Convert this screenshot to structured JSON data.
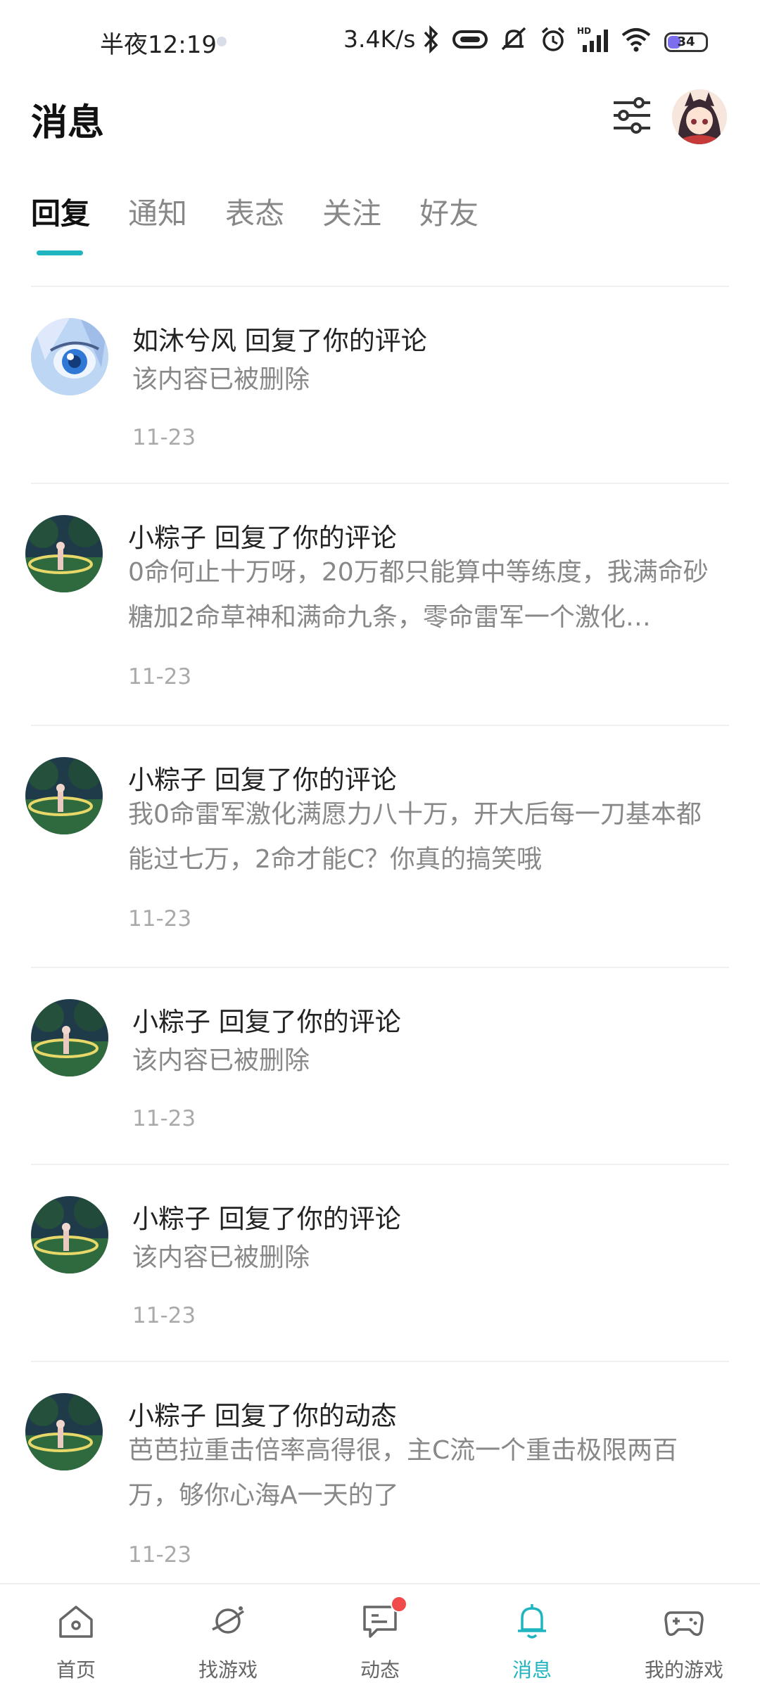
{
  "status_bar": {
    "time": "半夜12:19",
    "net_speed": "3.4K/s",
    "battery": "34",
    "battery_level": 0.34,
    "icons": [
      "bluetooth-icon",
      "vibrate-icon",
      "mute-icon",
      "alarm-icon",
      "signal-icon",
      "wifi-icon",
      "battery-icon"
    ]
  },
  "header": {
    "title": "消息",
    "filter_icon": "filter-sliders-icon"
  },
  "tabs": [
    {
      "label": "回复",
      "active": true
    },
    {
      "label": "通知",
      "active": false
    },
    {
      "label": "表态",
      "active": false
    },
    {
      "label": "关注",
      "active": false
    },
    {
      "label": "好友",
      "active": false
    }
  ],
  "messages": [
    {
      "title": "如沐兮风 回复了你的评论",
      "body": "该内容已被删除",
      "date": "11-23"
    },
    {
      "title": "小粽子 回复了你的评论",
      "body": "0命何止十万呀，20万都只能算中等练度，我满命砂糖加2命草神和满命九条，零命雷军一个激化…",
      "date": "11-23"
    },
    {
      "title": "小粽子 回复了你的评论",
      "body": "我0命雷军激化满愿力八十万，开大后每一刀基本都能过七万，2命才能C？你真的搞笑哦",
      "date": "11-23"
    },
    {
      "title": "小粽子 回复了你的评论",
      "body": "该内容已被删除",
      "date": "11-23"
    },
    {
      "title": "小粽子 回复了你的评论",
      "body": "该内容已被删除",
      "date": "11-23"
    },
    {
      "title": "小粽子 回复了你的动态",
      "body": "芭芭拉重击倍率高得很，主C流一个重击极限两百万，够你心海A一天的了",
      "date": "11-23"
    }
  ],
  "bottom_nav": [
    {
      "label": "首页",
      "icon": "home-icon",
      "active": false
    },
    {
      "label": "找游戏",
      "icon": "planet-icon",
      "active": false
    },
    {
      "label": "动态",
      "icon": "chat-icon",
      "active": false,
      "badge": true
    },
    {
      "label": "消息",
      "icon": "bell-icon",
      "active": true
    },
    {
      "label": "我的游戏",
      "icon": "gamepad-icon",
      "active": false
    }
  ],
  "colors": {
    "accent": "#1fb5c0",
    "badge": "#f04a4a"
  }
}
